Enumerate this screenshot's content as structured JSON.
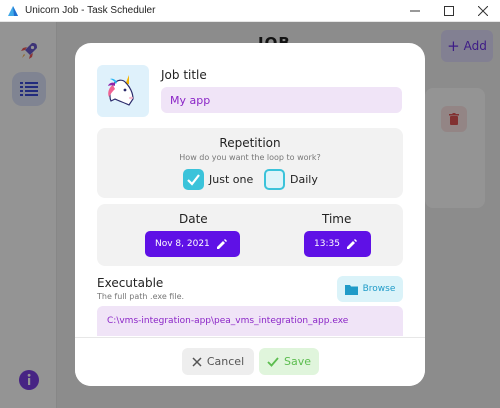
{
  "window": {
    "title": "Unicorn Job - Task Scheduler",
    "controls": {
      "minimize": "minimize-icon",
      "maximize": "maximize-icon",
      "close": "close-icon"
    }
  },
  "app": {
    "header_title": "JOB",
    "add_button_label": "Add",
    "sidebar": {
      "items": [
        "rocket-icon",
        "list-icon"
      ],
      "info": "info-icon"
    }
  },
  "dialog": {
    "job_title": {
      "label": "Job title",
      "value": "My app"
    },
    "repetition": {
      "title": "Repetition",
      "subtitle": "How do you want the loop to work?",
      "options": [
        {
          "label": "Just one",
          "checked": true
        },
        {
          "label": "Daily",
          "checked": false
        }
      ]
    },
    "schedule": {
      "date_label": "Date",
      "date_value": "Nov 8, 2021",
      "time_label": "Time",
      "time_value": "13:35"
    },
    "executable": {
      "label": "Executable",
      "hint": "The full path .exe file.",
      "browse_label": "Browse",
      "path": "C:\\vms-integration-app\\pea_vms_integration_app.exe"
    },
    "footer": {
      "cancel_label": "Cancel",
      "save_label": "Save"
    }
  },
  "colors": {
    "accent": "#5f11e6",
    "input_bg": "#f0e4f7",
    "input_text": "#8b25c7",
    "checkbox": "#3bc3da",
    "save": "#5cbd4f",
    "delete": "#e05555"
  }
}
